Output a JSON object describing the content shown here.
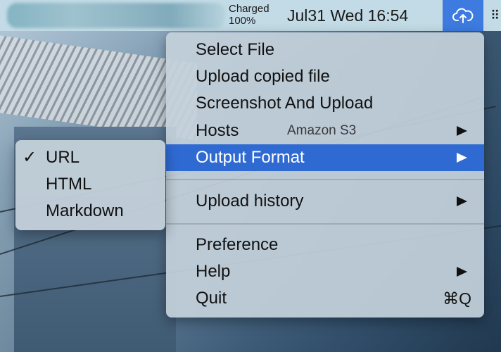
{
  "menubar": {
    "battery_status": "Charged",
    "battery_percent": "100%",
    "clock": "Jul31 Wed 16:54",
    "upload_icon": "cloud-upload-icon",
    "extra_icon": "grid-icon"
  },
  "menu": {
    "items": [
      {
        "label": "Select File"
      },
      {
        "label": "Upload copied file"
      },
      {
        "label": "Screenshot And Upload"
      },
      {
        "label": "Hosts",
        "detail": "Amazon S3"
      },
      {
        "label": "Output Format"
      },
      {
        "label": "Upload history"
      },
      {
        "label": "Preference"
      },
      {
        "label": "Help"
      },
      {
        "label": "Quit",
        "shortcut": "⌘Q"
      }
    ],
    "highlighted": "Output Format"
  },
  "submenu": {
    "items": [
      {
        "label": "URL",
        "checked": "✓"
      },
      {
        "label": "HTML"
      },
      {
        "label": "Markdown"
      }
    ]
  },
  "colors": {
    "highlight": "#2f6ad3",
    "menubar": "#c2dbe6",
    "upload_button": "#3d7be0"
  }
}
